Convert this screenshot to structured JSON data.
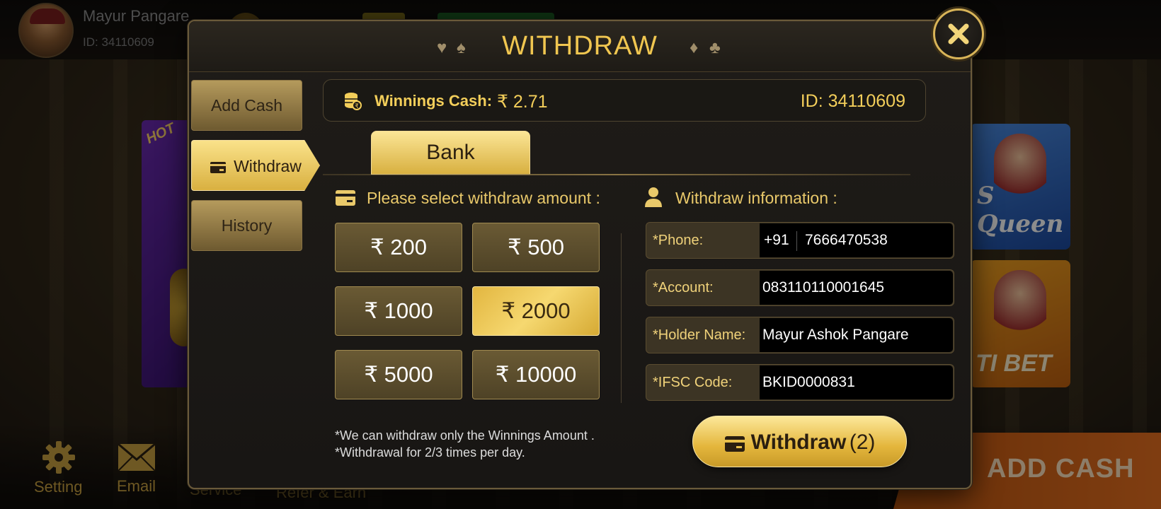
{
  "background": {
    "user": {
      "name": "Mayur Pangare",
      "id": "ID: 34110609"
    },
    "cards": {
      "right_top": "S Queen",
      "right_bottom": "TI BET",
      "left_badge": "HOT"
    },
    "bottom": {
      "setting": "Setting",
      "email": "Email",
      "service": "Service",
      "refer": "Refer & Earn",
      "add_cash": "ADD CASH"
    }
  },
  "modal": {
    "title": "WITHDRAW",
    "sidebar": [
      {
        "label": "Add Cash",
        "active": false
      },
      {
        "label": "Withdraw",
        "active": true
      },
      {
        "label": "History",
        "active": false
      }
    ],
    "winnings": {
      "label": "Winnings Cash:",
      "value": "₹ 2.71",
      "id": "ID: 34110609"
    },
    "bank_tab": "Bank",
    "amount_section_title": "Please select withdraw amount :",
    "amounts": [
      {
        "label": "₹ 200",
        "selected": false
      },
      {
        "label": "₹ 500",
        "selected": false
      },
      {
        "label": "₹ 1000",
        "selected": false
      },
      {
        "label": "₹ 2000",
        "selected": true
      },
      {
        "label": "₹ 5000",
        "selected": false
      },
      {
        "label": "₹ 10000",
        "selected": false
      }
    ],
    "info_section_title": "Withdraw information :",
    "fields": {
      "phone": {
        "label": "*Phone:",
        "prefix": "+91",
        "value": "7666470538"
      },
      "account": {
        "label": "*Account:",
        "value": "083110110001645"
      },
      "holder": {
        "label": "*Holder Name:",
        "value": "Mayur Ashok Pangare"
      },
      "ifsc": {
        "label": "*IFSC Code:",
        "value": "BKID0000831"
      }
    },
    "notes": [
      "*We can withdraw only the Winnings Amount .",
      "*Withdrawal for 2/3 times per day."
    ],
    "withdraw_button": {
      "label": "Withdraw",
      "count": "(2)"
    }
  },
  "colors": {
    "accent_gold": "#f0c650",
    "panel": "#1f1c18",
    "add_cash_orange": "#e87020"
  }
}
